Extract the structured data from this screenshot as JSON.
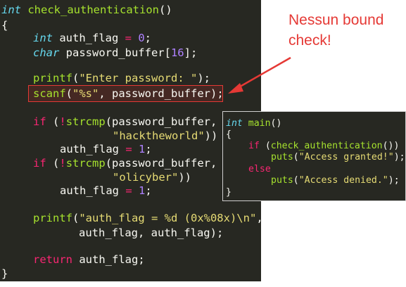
{
  "main_code": {
    "l1": {
      "type": "int",
      "fn": "check_authentication",
      "rest": "()"
    },
    "l2": "{",
    "l3": {
      "type": "int",
      "name": " auth_flag ",
      "op": "=",
      "num": " 0",
      "end": ";"
    },
    "l4": {
      "type": "char",
      "name": " password_buffer[",
      "num": "16",
      "end": "];"
    },
    "l5": {
      "fn": "printf",
      "open": "(",
      "str": "\"Enter password: \"",
      "end": ");"
    },
    "l6": {
      "fn": "scanf",
      "open": "(",
      "str": "\"%s\"",
      "end": ", password_buffer);"
    },
    "l7": {
      "kw": "if",
      "open": " (",
      "op": "!",
      "fn": "strcmp",
      "end": "(password_buffer,"
    },
    "l8": {
      "str": "\"hacktheworld\"",
      "end": "))"
    },
    "l9": {
      "name": "auth_flag ",
      "op": "=",
      "num": " 1",
      "end": ";"
    },
    "l10": {
      "kw": "if",
      "open": " (",
      "op": "!",
      "fn": "strcmp",
      "end": "(password_buffer,"
    },
    "l11": {
      "str": "\"olicyber\"",
      "end": "))"
    },
    "l12": {
      "name": "auth_flag ",
      "op": "=",
      "num": " 1",
      "end": ";"
    },
    "l13": {
      "fn": "printf",
      "open": "(",
      "str": "\"auth_flag = %d (0x%08x)\\n\"",
      "end": ","
    },
    "l14": "auth_flag, auth_flag);",
    "l15": {
      "kw": "return",
      "end": " auth_flag;"
    },
    "l16": "}"
  },
  "side_code": {
    "l1": {
      "type": "int",
      "fn": " main",
      "rest": "()"
    },
    "l2": "{",
    "l3": {
      "kw": "if",
      "open": " (",
      "fn": "check_authentication",
      "end": "())"
    },
    "l4": {
      "fn": "puts",
      "open": "(",
      "str": "\"Access granted!\"",
      "end": ");"
    },
    "l5": {
      "kw": "else"
    },
    "l6": {
      "fn": "puts",
      "open": "(",
      "str": "\"Access denied.\"",
      "end": ");"
    },
    "l7": "}"
  },
  "annotation": {
    "line1": "Nessun bound",
    "line2": "check!"
  },
  "colors": {
    "background": "#272822",
    "keyword": "#f92672",
    "type": "#66d9ef",
    "function": "#a6e22e",
    "string": "#e6db74",
    "number": "#ae81ff",
    "annotation": "#e53935"
  }
}
